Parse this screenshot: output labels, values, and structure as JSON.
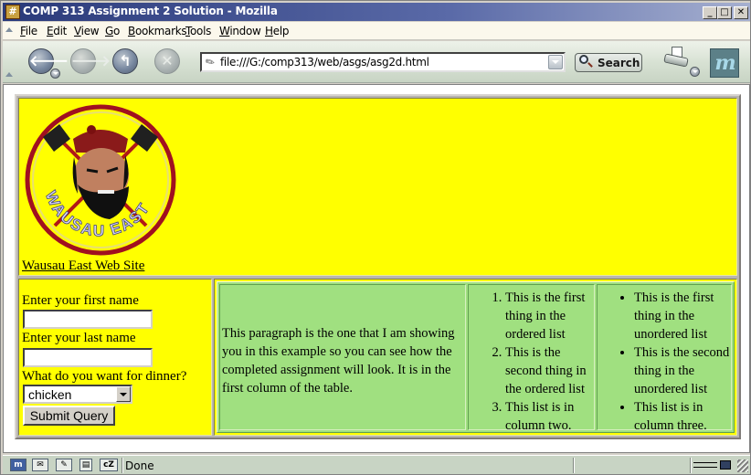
{
  "window": {
    "title": "COMP 313 Assignment 2 Solution - Mozilla",
    "app_icon": "mozilla-app-icon",
    "controls": {
      "minimize": "_",
      "maximize": "□",
      "close": "✕"
    }
  },
  "menubar": {
    "items": [
      {
        "label": "File"
      },
      {
        "label": "Edit"
      },
      {
        "label": "View"
      },
      {
        "label": "Go"
      },
      {
        "label": "Bookmarks"
      },
      {
        "label": "Tools"
      },
      {
        "label": "Window"
      },
      {
        "label": "Help"
      }
    ]
  },
  "navbar": {
    "back": "🡐",
    "forward": "🡒",
    "reload": "↰",
    "stop": "✕",
    "url": "file:///G:/comp313/web/asgs/asg2d.html",
    "search_label": "Search",
    "logo": "m"
  },
  "page": {
    "site_link": "Wausau East Web Site",
    "logo_text": "WAUSAU EAST",
    "form": {
      "first_name_label": "Enter your first name",
      "first_name_value": "",
      "last_name_label": "Enter your last name",
      "last_name_value": "",
      "dinner_label": "What do you want for dinner?",
      "dinner_selected": "chicken",
      "submit_label": "Submit Query"
    },
    "paragraph": "This paragraph is the one that I am showing you in this example so you can see how the completed assignment will look. It is in the first column of the table.",
    "ordered_list": [
      "This is the first thing in the ordered list",
      "This is the second thing in the ordered list",
      "This list is in column two."
    ],
    "unordered_list": [
      "This is the first thing in the unordered list",
      "This is the second thing in the unordered list",
      "This list is in column three."
    ],
    "colors": {
      "header_bg": "#ffff00",
      "table_bg": "#a0e080",
      "logo_ring": "#a01020"
    }
  },
  "statusbar": {
    "icons": [
      "navigator-icon",
      "mail-icon",
      "composer-icon",
      "address-book-icon",
      "chatzilla-icon"
    ],
    "icon_labels": [
      "m",
      "✉",
      "✎",
      "▤",
      "cZ"
    ],
    "status": "Done",
    "online_icon": "connection-icon",
    "security_icon": "unlocked-padlock-icon"
  }
}
